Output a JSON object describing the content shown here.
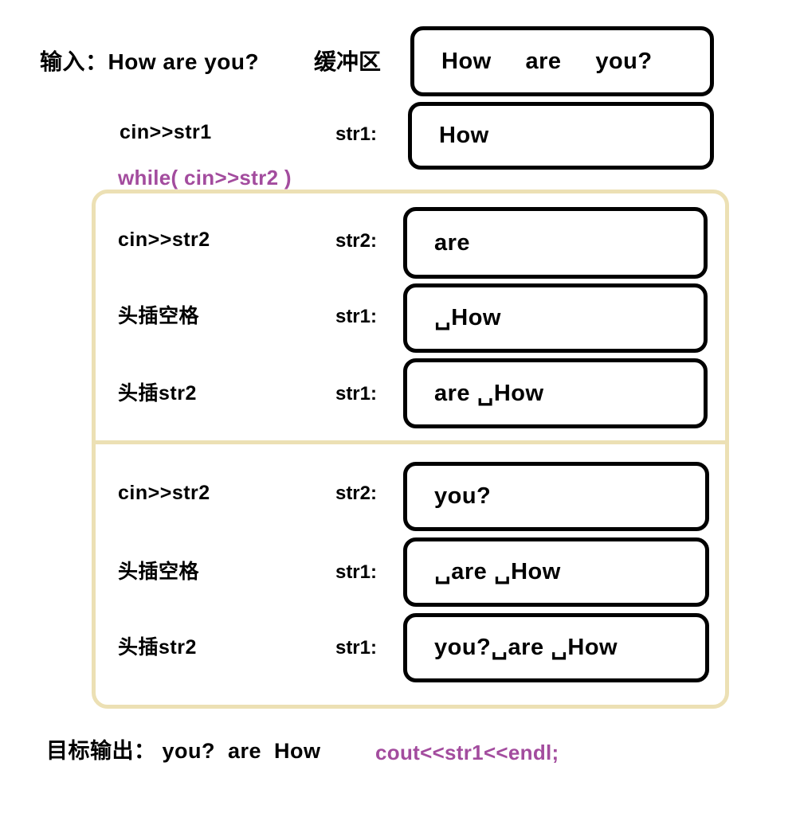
{
  "header": {
    "input_label": "输入：How are you?",
    "buffer_label": "缓冲区",
    "buffer_value": "How     are     you?"
  },
  "init_step": {
    "op_label": "cin>>str1",
    "var_label": "str1:",
    "value": "How"
  },
  "while_header": "while( cin>>str2 )",
  "iterations": [
    {
      "steps": [
        {
          "op_label": "cin>>str2",
          "var_label": "str2:",
          "value": "are"
        },
        {
          "op_label": "头插空格",
          "var_label": "str1:",
          "value": "␣How"
        },
        {
          "op_label": "头插str2",
          "var_label": "str1:",
          "value": "are ␣How"
        }
      ]
    },
    {
      "steps": [
        {
          "op_label": "cin>>str2",
          "var_label": "str2:",
          "value": "you?"
        },
        {
          "op_label": "头插空格",
          "var_label": "str1:",
          "value": "␣are ␣How"
        },
        {
          "op_label": "头插str2",
          "var_label": "str1:",
          "value": "you?␣are ␣How"
        }
      ]
    }
  ],
  "footer": {
    "goal_label": "目标输出： you?  are  How",
    "code": "cout<<str1<<endl;"
  },
  "colors": {
    "purple": "#a34c9e",
    "loop_border": "#ece0b4",
    "box_border": "#000000",
    "text": "#000000"
  }
}
